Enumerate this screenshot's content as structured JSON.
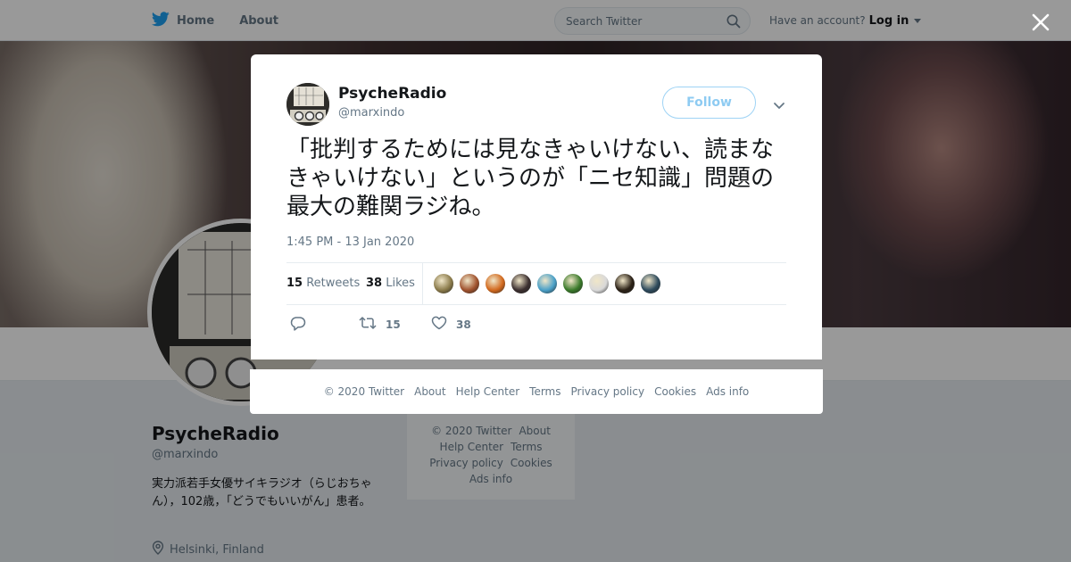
{
  "colors": {
    "accent": "#1da1f2",
    "follow_border": "#9ed3f5",
    "muted": "#657786"
  },
  "topnav": {
    "home_label": "Home",
    "about_label": "About",
    "search_placeholder": "Search Twitter",
    "account_prompt": "Have an account?",
    "login_label": "Log in"
  },
  "profile": {
    "name": "PsycheRadio",
    "handle": "@marxindo",
    "bio": "実力派若手女優サイキラジオ（らじおちゃん），102歳，「どうでもいいがん」患者。",
    "location": "Helsinki, Finland"
  },
  "bg_footer": {
    "rows": [
      [
        "© 2020 Twitter",
        "About"
      ],
      [
        "Help Center",
        "Terms"
      ],
      [
        "Privacy policy",
        "Cookies"
      ],
      [
        "Ads info"
      ]
    ]
  },
  "tweet": {
    "author_name": "PsycheRadio",
    "author_handle": "@marxindo",
    "follow_label": "Follow",
    "text": "「批判するためには見なきゃいけない、読まなきゃいけない」というのが「ニセ知識」問題の最大の難関ラジね。",
    "timestamp": "1:45 PM - 13 Jan 2020",
    "retweets_count": "15",
    "retweets_label": "Retweets",
    "likes_count": "38",
    "likes_label": "Likes",
    "liker_colors": [
      "#8a7a4a",
      "#a0522d",
      "#d2691e",
      "#3b2f2f",
      "#4aa0c8",
      "#3a7a2a",
      "#d9d9d9",
      "#2b2116",
      "#2d4a5c"
    ],
    "action_retweet_count": "15",
    "action_like_count": "38"
  },
  "footer": {
    "copyright": "© 2020 Twitter",
    "about": "About",
    "help": "Help Center",
    "terms": "Terms",
    "privacy": "Privacy policy",
    "cookies": "Cookies",
    "ads": "Ads info"
  }
}
